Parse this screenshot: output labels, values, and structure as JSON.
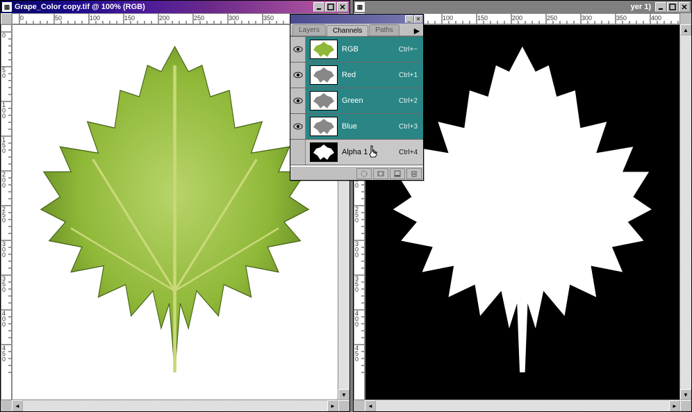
{
  "left_window": {
    "title": "Grape_Color copy.tif @ 100% (RGB)"
  },
  "right_window": {
    "title_suffix": "yer 1)"
  },
  "ruler_ticks": [
    "0",
    "50",
    "100",
    "150",
    "200",
    "250",
    "300",
    "350",
    "400",
    "450"
  ],
  "panel": {
    "tabs": [
      "Layers",
      "Channels",
      "Paths"
    ],
    "active_tab": "Channels",
    "channels": [
      {
        "name": "RGB",
        "shortcut": "Ctrl+~",
        "visible": true,
        "selected": true,
        "thumb": "color"
      },
      {
        "name": "Red",
        "shortcut": "Ctrl+1",
        "visible": true,
        "selected": true,
        "thumb": "gray"
      },
      {
        "name": "Green",
        "shortcut": "Ctrl+2",
        "visible": true,
        "selected": true,
        "thumb": "gray"
      },
      {
        "name": "Blue",
        "shortcut": "Ctrl+3",
        "visible": true,
        "selected": true,
        "thumb": "gray"
      },
      {
        "name": "Alpha 1",
        "shortcut": "Ctrl+4",
        "visible": false,
        "selected": false,
        "thumb": "alpha"
      }
    ]
  }
}
